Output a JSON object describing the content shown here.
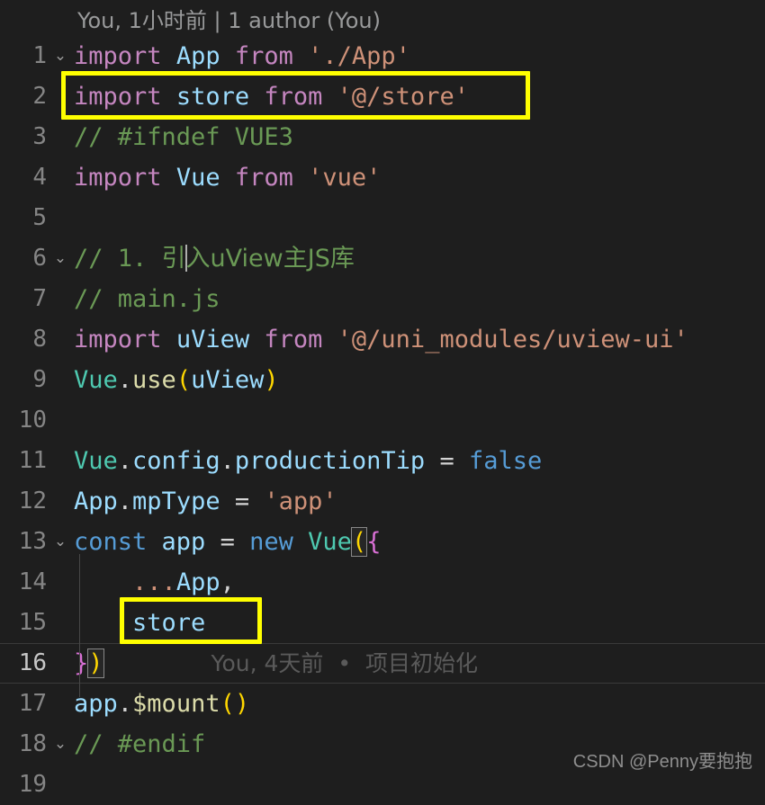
{
  "editor": {
    "theme_background": "#1e1e1e",
    "line_number_color": "#858585",
    "highlight_box_color": "#ffff00",
    "blame_header": "You, 1小时前 | 1 author (You)",
    "inline_blame": {
      "line": 16,
      "text": "You, 4天前  •  项目初始化"
    },
    "current_line": 16,
    "lines": [
      {
        "number": "1",
        "fold": "chevron-down-icon",
        "text": "import App from './App'"
      },
      {
        "number": "2",
        "fold": "",
        "text": "import store from '@/store'"
      },
      {
        "number": "3",
        "fold": "",
        "text": "// #ifndef VUE3"
      },
      {
        "number": "4",
        "fold": "",
        "text": "import Vue from 'vue'"
      },
      {
        "number": "5",
        "fold": "",
        "text": ""
      },
      {
        "number": "6",
        "fold": "chevron-down-icon",
        "text": "// 1. 引入uView主JS库"
      },
      {
        "number": "7",
        "fold": "",
        "text": "// main.js"
      },
      {
        "number": "8",
        "fold": "",
        "text": "import uView from '@/uni_modules/uview-ui'"
      },
      {
        "number": "9",
        "fold": "",
        "text": "Vue.use(uView)"
      },
      {
        "number": "10",
        "fold": "",
        "text": ""
      },
      {
        "number": "11",
        "fold": "",
        "text": "Vue.config.productionTip = false"
      },
      {
        "number": "12",
        "fold": "",
        "text": "App.mpType = 'app'"
      },
      {
        "number": "13",
        "fold": "chevron-down-icon",
        "text": "const app = new Vue({"
      },
      {
        "number": "14",
        "fold": "",
        "text": "    ...App,"
      },
      {
        "number": "15",
        "fold": "",
        "text": "    store"
      },
      {
        "number": "16",
        "fold": "",
        "text": "})"
      },
      {
        "number": "17",
        "fold": "",
        "text": "app.$mount()"
      },
      {
        "number": "18",
        "fold": "chevron-down-icon",
        "text": "// #endif"
      },
      {
        "number": "19",
        "fold": "",
        "text": ""
      }
    ],
    "highlights": [
      {
        "name": "import-store-highlight",
        "target_line": 2,
        "label": "import store from '@/store'"
      },
      {
        "name": "store-highlight",
        "target_line": 15,
        "label": "store"
      }
    ]
  },
  "watermark": "CSDN @Penny要抱抱"
}
